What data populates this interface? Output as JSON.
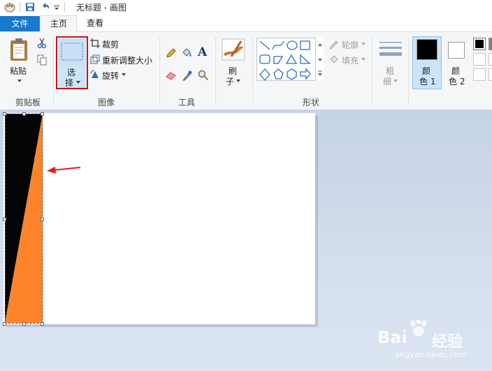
{
  "window": {
    "title": "无标题 - 画图"
  },
  "tabs": [
    {
      "label": "文件"
    },
    {
      "label": "主页"
    },
    {
      "label": "查看"
    }
  ],
  "ribbon": {
    "clipboard": {
      "paste_label": "粘贴",
      "group_label": "剪贴板"
    },
    "image": {
      "select_label_line1": "选",
      "select_label_line2": "择",
      "crop_label": "裁剪",
      "resize_label": "重新调整大小",
      "rotate_label": "旋转",
      "group_label": "图像"
    },
    "tools": {
      "group_label": "工具",
      "text_tool_glyph": "A"
    },
    "brushes": {
      "label_line1": "刷",
      "label_line2": "子"
    },
    "shapes": {
      "outline_label": "轮廓",
      "fill_label": "填充",
      "group_label": "形状"
    },
    "size": {
      "label_line1": "粗",
      "label_line2": "细"
    },
    "colors": {
      "color1_line1": "颜",
      "color1_line2": "色 1",
      "color2_line1": "颜",
      "color2_line2": "色 2",
      "color1_value": "#000000",
      "color2_value": "#ffffff"
    }
  },
  "canvas": {
    "shape_colors": {
      "dark": "#050505",
      "orange": "#fd8429"
    },
    "arrow_color": "#e31d1d"
  },
  "watermark": {
    "brand": "Bai",
    "brand_cn": "经验",
    "url": "jingyan.baidu.com"
  },
  "accent": "#1979ca"
}
